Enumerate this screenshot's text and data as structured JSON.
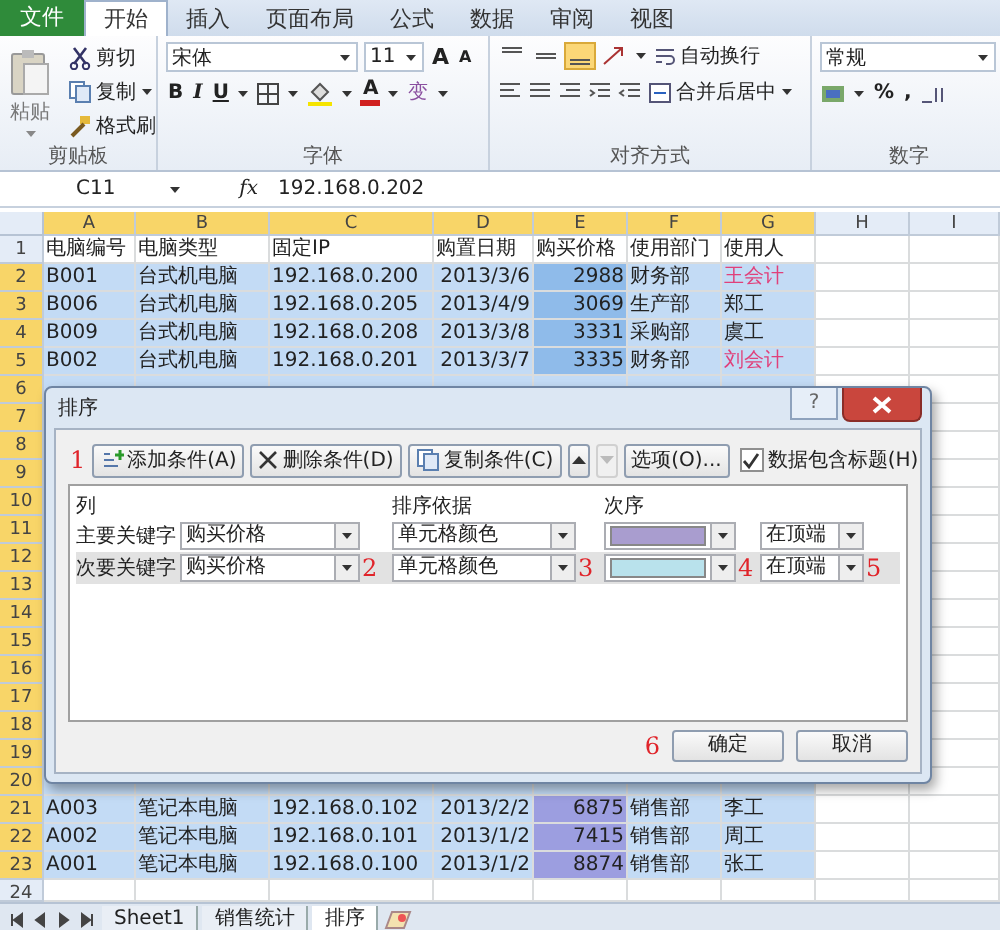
{
  "ribbon_tabs": [
    {
      "label": "文件",
      "kind": "file",
      "selected": false
    },
    {
      "label": "开始",
      "kind": "tab",
      "selected": true
    },
    {
      "label": "插入",
      "kind": "tab",
      "selected": false
    },
    {
      "label": "页面布局",
      "kind": "tab",
      "selected": false
    },
    {
      "label": "公式",
      "kind": "tab",
      "selected": false
    },
    {
      "label": "数据",
      "kind": "tab",
      "selected": false
    },
    {
      "label": "审阅",
      "kind": "tab",
      "selected": false
    },
    {
      "label": "视图",
      "kind": "tab",
      "selected": false
    }
  ],
  "ribbon": {
    "clipboard": {
      "paste": "粘贴",
      "cut": "剪切",
      "copy": "复制",
      "format_painter": "格式刷",
      "label": "剪贴板"
    },
    "font": {
      "name": "宋体",
      "size": "11",
      "grow": "A",
      "shrink": "A",
      "bold": "B",
      "italic": "I",
      "underline": "U",
      "font_color": "A",
      "phonetic": "变",
      "label": "字体"
    },
    "alignment": {
      "vertical_align_buttons": [
        {
          "selected": false
        },
        {
          "selected": false
        },
        {
          "selected": true
        }
      ],
      "wrap": "自动换行",
      "merge": "合并后居中",
      "label": "对齐方式"
    },
    "number": {
      "format": "常规",
      "percent": "%",
      "comma": ",",
      "label": "数字"
    }
  },
  "formula_bar": {
    "cell": "C11",
    "fx": "fx",
    "value": "192.168.0.202"
  },
  "sheet": {
    "columns": [
      {
        "label": "A",
        "selected": true
      },
      {
        "label": "B",
        "selected": true
      },
      {
        "label": "C",
        "selected": true
      },
      {
        "label": "D",
        "selected": true
      },
      {
        "label": "E",
        "selected": true,
        "kind": "fill"
      },
      {
        "label": "F",
        "selected": true
      },
      {
        "label": "G",
        "selected": true,
        "kind": "text"
      },
      {
        "label": "H",
        "selected": false
      },
      {
        "label": "I",
        "selected": false
      }
    ],
    "rows": [
      {
        "number": "1",
        "selected": false,
        "cells": [
          "电脑编号",
          "电脑类型",
          "固定IP",
          "购置日期",
          "购买价格",
          "使用部门",
          "使用人"
        ]
      },
      {
        "number": "2",
        "selected": true,
        "cells": [
          "B001",
          "台式机电脑",
          "192.168.0.200",
          "2013/3/6",
          {
            "text": "2988",
            "color": "#8fbbea"
          },
          "财务部",
          {
            "text": "王会计",
            "color": "#e0407a"
          }
        ]
      },
      {
        "number": "3",
        "selected": true,
        "cells": [
          "B006",
          "台式机电脑",
          "192.168.0.205",
          "2013/4/9",
          {
            "text": "3069",
            "color": "#8fbbea"
          },
          "生产部",
          {
            "text": "郑工",
            "color": "#222222"
          }
        ]
      },
      {
        "number": "4",
        "selected": true,
        "cells": [
          "B009",
          "台式机电脑",
          "192.168.0.208",
          "2013/3/8",
          {
            "text": "3331",
            "color": "#8fbbea"
          },
          "采购部",
          {
            "text": "虞工",
            "color": "#222222"
          }
        ]
      },
      {
        "number": "5",
        "selected": true,
        "cells": [
          "B002",
          "台式机电脑",
          "192.168.0.201",
          "2013/3/7",
          {
            "text": "3335",
            "color": "#8fbbea"
          },
          "财务部",
          {
            "text": "刘会计",
            "color": "#e0407a"
          }
        ]
      },
      {
        "number": "6",
        "selected": true
      },
      {
        "number": "7",
        "selected": true
      },
      {
        "number": "8",
        "selected": true
      },
      {
        "number": "9",
        "selected": true
      },
      {
        "number": "10",
        "selected": true
      },
      {
        "number": "11",
        "selected": true
      },
      {
        "number": "12",
        "selected": true
      },
      {
        "number": "13",
        "selected": true
      },
      {
        "number": "14",
        "selected": true
      },
      {
        "number": "15",
        "selected": true
      },
      {
        "number": "16",
        "selected": true
      },
      {
        "number": "17",
        "selected": true
      },
      {
        "number": "18",
        "selected": true
      },
      {
        "number": "19",
        "selected": true
      },
      {
        "number": "20",
        "selected": true
      },
      {
        "number": "21",
        "selected": true,
        "cells": [
          "A003",
          "笔记本电脑",
          "192.168.0.102",
          "2013/2/2",
          {
            "text": "6875",
            "color": "#9c9ee0"
          },
          "销售部",
          {
            "text": "李工",
            "color": "#222222"
          }
        ]
      },
      {
        "number": "22",
        "selected": true,
        "cells": [
          "A002",
          "笔记本电脑",
          "192.168.0.101",
          "2013/1/2",
          {
            "text": "7415",
            "color": "#9c9ee0"
          },
          "销售部",
          {
            "text": "周工",
            "color": "#222222"
          }
        ]
      },
      {
        "number": "23",
        "selected": true,
        "cells": [
          "A001",
          "笔记本电脑",
          "192.168.0.100",
          "2013/1/2",
          {
            "text": "8874",
            "color": "#9c9ee0"
          },
          "销售部",
          {
            "text": "张工",
            "color": "#222222"
          }
        ]
      },
      {
        "number": "24",
        "selected": false
      }
    ]
  },
  "sheet_tabs": [
    {
      "label": "Sheet1",
      "selected": false
    },
    {
      "label": "销售统计",
      "selected": false
    },
    {
      "label": "排序",
      "selected": true
    }
  ],
  "sort_dialog": {
    "title": "排序",
    "help": "?",
    "add": {
      "label": "添加条件(A)",
      "annotation": "1"
    },
    "delete": "删除条件(D)",
    "copy": "复制条件(C)",
    "move_buttons": [
      {
        "kind": "up",
        "disabled": false
      },
      {
        "kind": "down",
        "disabled": true
      }
    ],
    "options": "选项(O)...",
    "has_headers": {
      "label": "数据包含标题(H)",
      "checked": true
    },
    "headers": [
      "列",
      "排序依据",
      "次序"
    ],
    "levels": [
      {
        "label": "主要关键字",
        "column": "购买价格",
        "sort_on": "单元格颜色",
        "color": "#a99dcf",
        "order": "在顶端",
        "selected": false
      },
      {
        "label": "次要关键字",
        "column": "购买价格",
        "sort_on": "单元格颜色",
        "color": "#b9e2ec",
        "order": "在顶端",
        "selected": true,
        "annotations": {
          "column": "2",
          "sort_on": "3",
          "swatch": "4",
          "order": "5"
        }
      }
    ],
    "ok": {
      "label": "确定",
      "annotation": "6"
    },
    "cancel": "取消"
  }
}
